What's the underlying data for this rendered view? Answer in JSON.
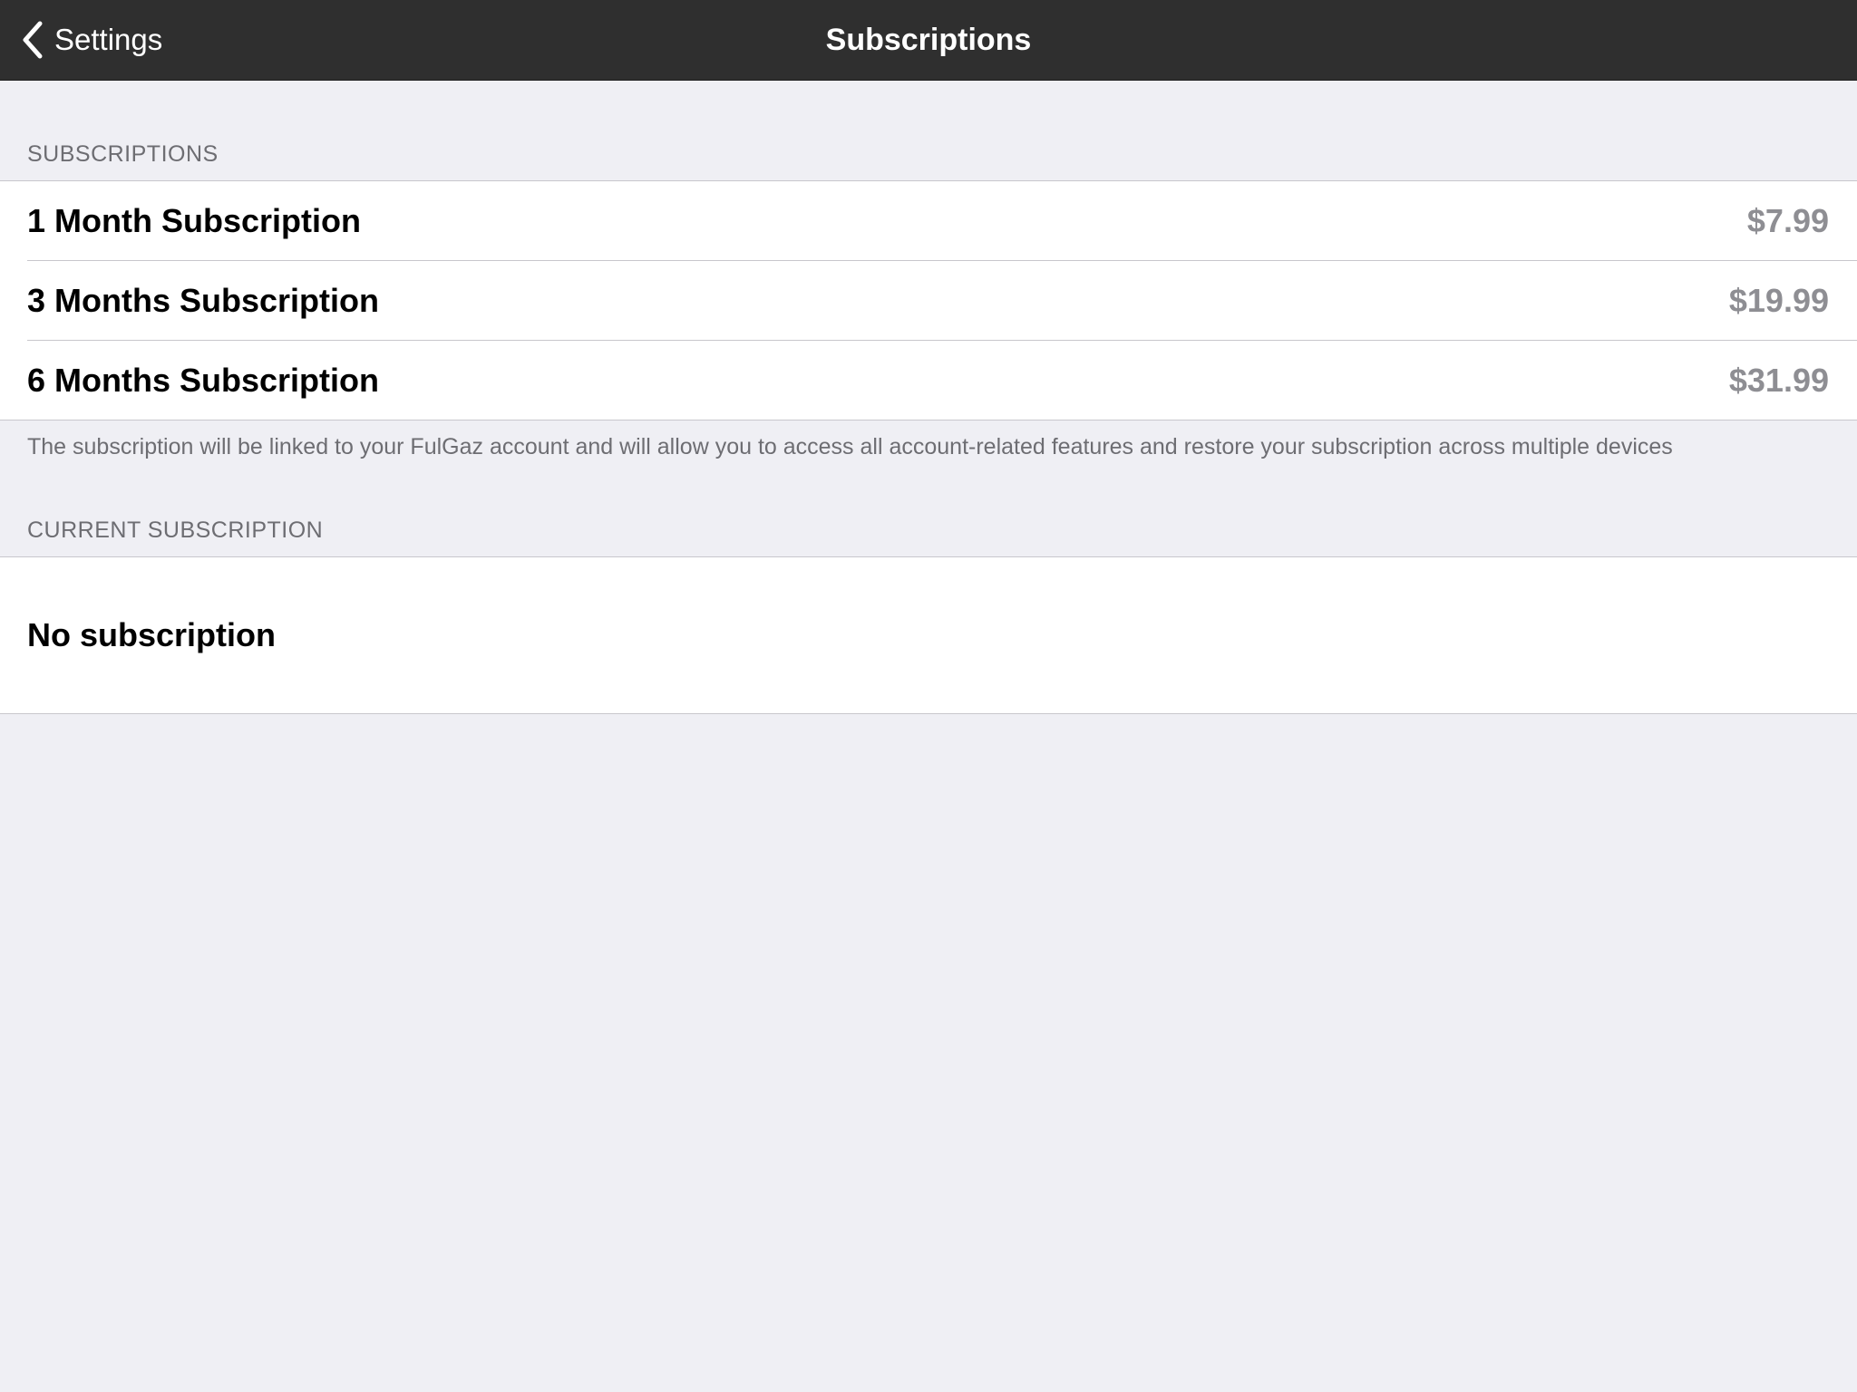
{
  "navbar": {
    "back_label": "Settings",
    "title": "Subscriptions"
  },
  "subscriptions_section": {
    "header": "SUBSCRIPTIONS",
    "items": [
      {
        "title": "1 Month Subscription",
        "price": "$7.99"
      },
      {
        "title": "3 Months Subscription",
        "price": "$19.99"
      },
      {
        "title": "6 Months Subscription",
        "price": "$31.99"
      }
    ],
    "footer": "The subscription will be linked to your FulGaz account and will allow you to access all account-related features and restore your subscription across multiple devices"
  },
  "current_section": {
    "header": "CURRENT SUBSCRIPTION",
    "status": "No subscription"
  },
  "icons": {
    "back": "chevron-left-icon"
  },
  "colors": {
    "navbar_background": "#2f2f2f",
    "page_background": "#efeff4",
    "price_text": "#8e8e93",
    "section_header_text": "#6d6d72"
  }
}
